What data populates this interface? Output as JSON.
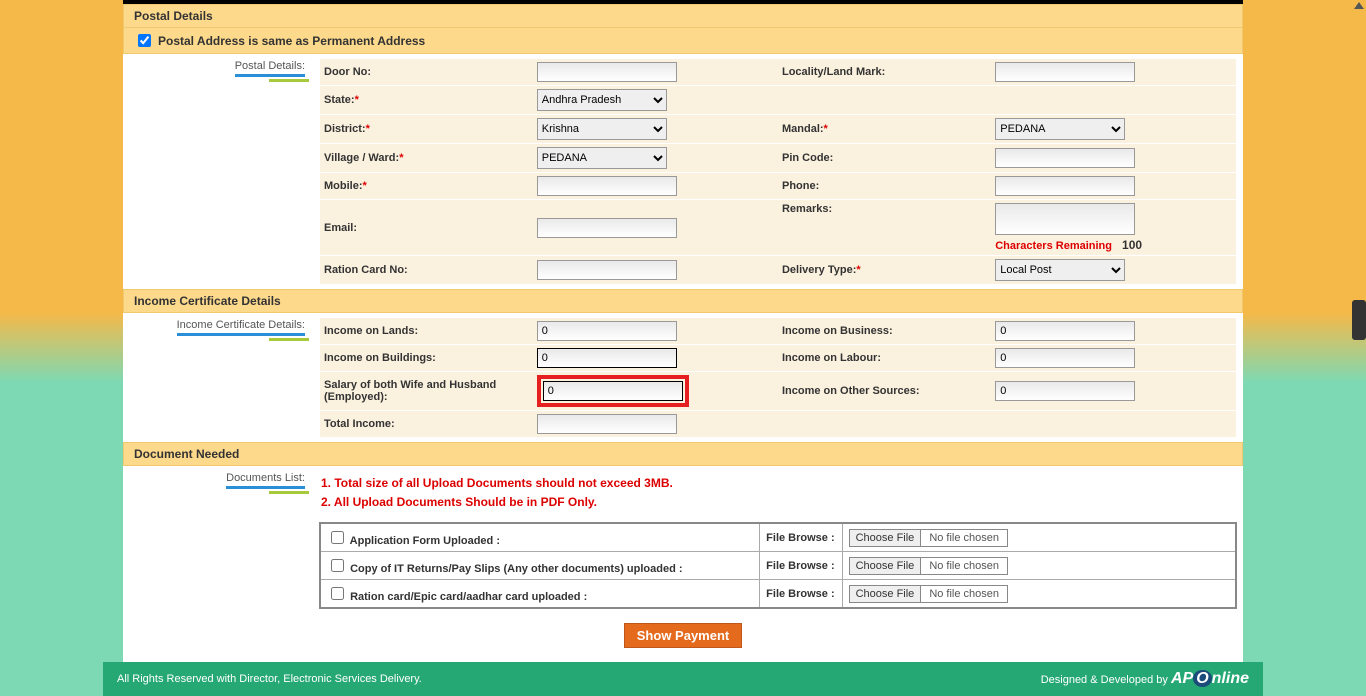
{
  "postal": {
    "head": "Postal Details",
    "same_label": "Postal Address is same as Permanent Address",
    "side": "Postal Details:",
    "doorno": "Door No:",
    "locality": "Locality/Land Mark:",
    "state": "State:",
    "state_val": "Andhra Pradesh",
    "district": "District:",
    "district_val": "Krishna",
    "mandal": "Mandal:",
    "mandal_val": "PEDANA",
    "village": "Village / Ward:",
    "village_val": "PEDANA",
    "pincode": "Pin Code:",
    "mobile": "Mobile:",
    "phone": "Phone:",
    "email": "Email:",
    "remarks": "Remarks:",
    "char_rem": "Characters Remaining",
    "char_rem_n": "100",
    "ration": "Ration Card No:",
    "delivery": "Delivery Type:",
    "delivery_val": "Local Post"
  },
  "income": {
    "head": "Income Certificate Details",
    "side": "Income Certificate Details:",
    "lands": "Income on Lands:",
    "lands_v": "0",
    "business": "Income on Business:",
    "business_v": "0",
    "buildings": "Income on Buildings:",
    "buildings_v": "0",
    "labour": "Income on Labour:",
    "labour_v": "0",
    "salary": "Salary of both Wife and Husband (Employed):",
    "salary_v": "0",
    "other": "Income on Other Sources:",
    "other_v": "0",
    "total": "Total Income:"
  },
  "docs": {
    "head": "Document Needed",
    "side": "Documents List:",
    "note1": "1. Total size of all Upload Documents should not exceed 3MB.",
    "note2": "2. All Upload Documents Should be in PDF Only.",
    "r1": "Application Form Uploaded :",
    "r2": "Copy of IT Returns/Pay Slips (Any other documents) uploaded :",
    "r3": "Ration card/Epic card/aadhar card uploaded :",
    "browse": "File Browse :",
    "choose": "Choose File",
    "nofile": "No file chosen"
  },
  "show_payment": "Show Payment",
  "footer": {
    "left": "All Rights Reserved with Director, Electronic Services Delivery.",
    "right": "Designed & Developed by"
  }
}
